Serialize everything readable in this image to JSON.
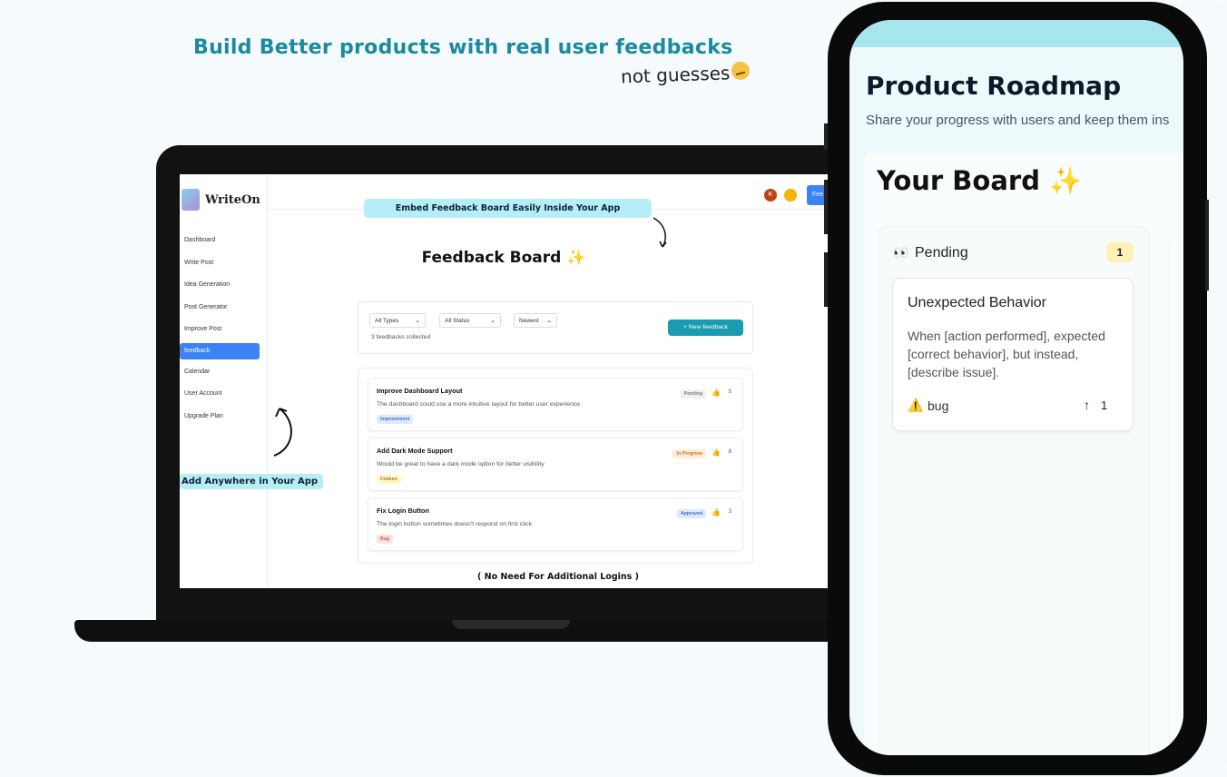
{
  "hero": {
    "tagline": "Build Better products with real user feedbacks",
    "subtagline": "not guesses"
  },
  "laptop": {
    "app_name": "WriteOn",
    "nav": [
      {
        "label": "Dashboard"
      },
      {
        "label": "Write Post"
      },
      {
        "label": "Idea Generation"
      },
      {
        "label": "Post Generator"
      },
      {
        "label": "Improve Post"
      },
      {
        "label": "feedback",
        "active": true
      },
      {
        "label": "Calendar"
      },
      {
        "label": "User Account"
      },
      {
        "label": "Upgrade Plan"
      }
    ],
    "annotation_left": "Add Anywhere in Your App",
    "annotation_top": "Embed Feedback Board Easily Inside Your App",
    "avatar_initial": "K",
    "top_button": "Fee",
    "board_title": "Feedback Board",
    "filters": {
      "type": "All Types",
      "status": "All Status",
      "sort": "Newest"
    },
    "count_text": "3 feedbacks collected",
    "new_button": "+   New feedback",
    "feedbacks": [
      {
        "title": "Improve Dashboard Layout",
        "desc": "The dashboard could use a more intuitive layout for better user experience",
        "tag": "Improvement",
        "status": "Pending",
        "likes": "5"
      },
      {
        "title": "Add Dark Mode Support",
        "desc": "Would be great to have a dark mode option for better visibility",
        "tag": "Feature",
        "status": "In Progress",
        "likes": "8"
      },
      {
        "title": "Fix Login Button",
        "desc": "The login button sometimes doesn't respond on first click",
        "tag": "Bug",
        "status": "Approved",
        "likes": "3"
      }
    ],
    "footer_note": "( No Need For Additional Logins )"
  },
  "phone": {
    "title": "Product Roadmap",
    "subtitle": "Share your progress with users and keep them ins",
    "board_title": "Your Board",
    "column": {
      "title": "Pending",
      "count": "1",
      "card": {
        "title": "Unexpected Behavior",
        "desc": "When [action performed], expected [correct behavior], but instead, [describe issue].",
        "tag": "bug",
        "upvotes": "1"
      }
    }
  },
  "colors": {
    "accent": "#1b8aa0",
    "button": "#1a9bb0",
    "highlight": "#b5eef6",
    "active_nav": "#3b82f6"
  }
}
